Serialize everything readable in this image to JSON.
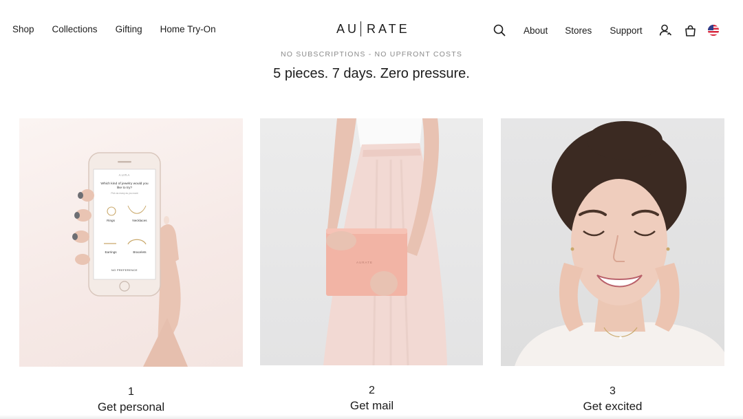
{
  "nav": {
    "left_items": [
      "Shop",
      "Collections",
      "Gifting",
      "Home Try-On"
    ],
    "logo_left": "AU",
    "logo_right": "RATE",
    "right_items": [
      "About",
      "Stores",
      "Support"
    ],
    "icons": [
      "search-icon",
      "account-icon",
      "cart-icon",
      "us-flag-icon"
    ]
  },
  "hero": {
    "eyebrow": "NO SUBSCRIPTIONS - NO UPFRONT COSTS",
    "headline": "5 pieces. 7 days. Zero pressure."
  },
  "steps": [
    {
      "number": "1",
      "title": "Get personal",
      "image": "hand holding phone with jewelry quiz"
    },
    {
      "number": "2",
      "title": "Get mail",
      "image": "woman in pink skirt holding pink box"
    },
    {
      "number": "3",
      "title": "Get excited",
      "image": "smiling woman wearing rings and necklace"
    }
  ],
  "phone_screen": {
    "brand": "AURA",
    "question": "Which kind of jewelry would you like to try?",
    "subtext": "Pick as many as you want",
    "options": [
      "Rings",
      "Necklaces",
      "Earrings",
      "Bracelets"
    ],
    "footer": "NO PREFERENCE"
  },
  "box_logo": "AURATE",
  "colors": {
    "text": "#1c1c1c",
    "muted": "#8a8a8a",
    "panel1_bg": "#f6ece9",
    "panel2_bg": "#e9e9ea",
    "panel3_bg": "#e4e4e5",
    "box": "#f0b3a4"
  }
}
